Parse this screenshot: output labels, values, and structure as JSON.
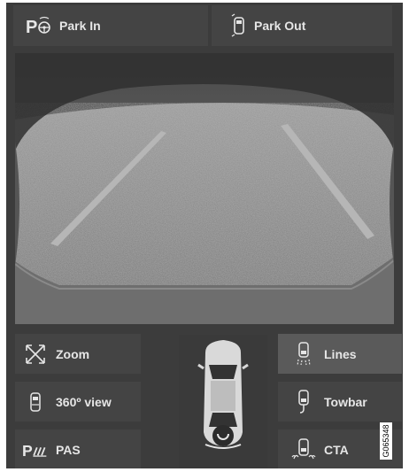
{
  "top_buttons": {
    "park_in": "Park In",
    "park_out": "Park Out"
  },
  "left_buttons": [
    {
      "label": "Zoom",
      "icon": "zoom-icon"
    },
    {
      "label": "360º view",
      "icon": "360-view-icon"
    },
    {
      "label": "PAS",
      "icon": "pas-icon"
    }
  ],
  "right_buttons": [
    {
      "label": "Lines",
      "icon": "lines-icon",
      "active": true
    },
    {
      "label": "Towbar",
      "icon": "towbar-icon"
    },
    {
      "label": "CTA",
      "icon": "cta-icon"
    }
  ],
  "image_code": "G065348",
  "colors": {
    "panel": "#3c3c3c",
    "button": "#444444",
    "button_active": "#5a5a5a",
    "text": "#e6e6e6"
  }
}
